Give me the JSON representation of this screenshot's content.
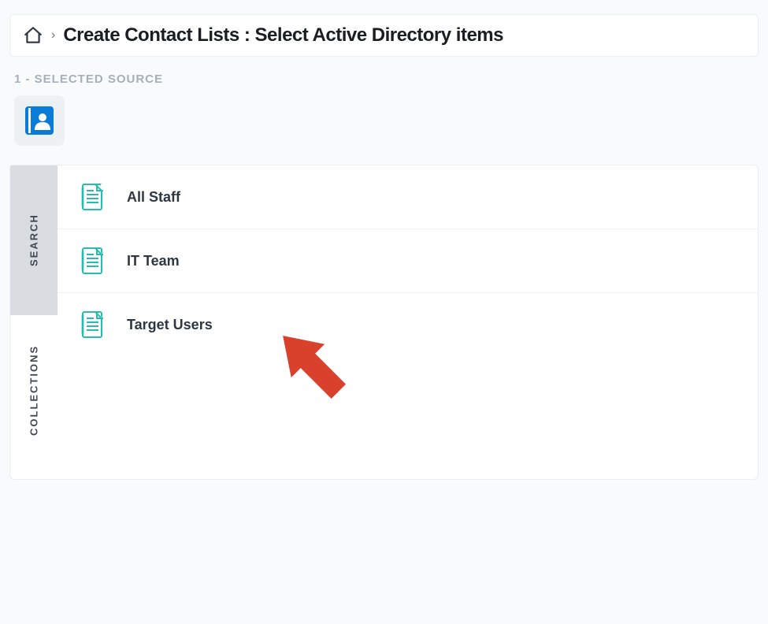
{
  "breadcrumb": {
    "title": "Create Contact Lists  :   Select Active Directory items"
  },
  "step": {
    "label": "1 - SELECTED SOURCE"
  },
  "source": {
    "icon": "contacts-book"
  },
  "tabs": {
    "active": "SEARCH",
    "inactive": "COLLECTIONS"
  },
  "collections": [
    {
      "label": "All Staff"
    },
    {
      "label": "IT Team"
    },
    {
      "label": "Target Users"
    }
  ],
  "colors": {
    "accent_blue": "#0a7bd6",
    "teal": "#29bbb0",
    "arrow_red": "#d9412c"
  }
}
